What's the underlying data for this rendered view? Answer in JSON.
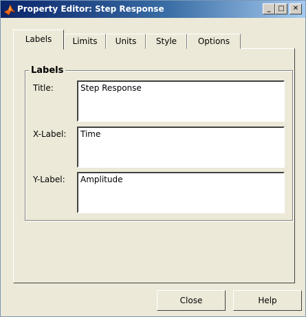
{
  "window": {
    "title": "Property Editor: Step Response"
  },
  "tabs": [
    {
      "label": "Labels"
    },
    {
      "label": "Limits"
    },
    {
      "label": "Units"
    },
    {
      "label": "Style"
    },
    {
      "label": "Options"
    }
  ],
  "labels_group": {
    "title": "Labels",
    "fields": [
      {
        "label": "Title:",
        "value": "Step Response"
      },
      {
        "label": "X-Label:",
        "value": "Time"
      },
      {
        "label": "Y-Label:",
        "value": "Amplitude"
      }
    ]
  },
  "buttons": {
    "close": "Close",
    "help": "Help"
  },
  "icons": {
    "app": "matlab-icon"
  }
}
